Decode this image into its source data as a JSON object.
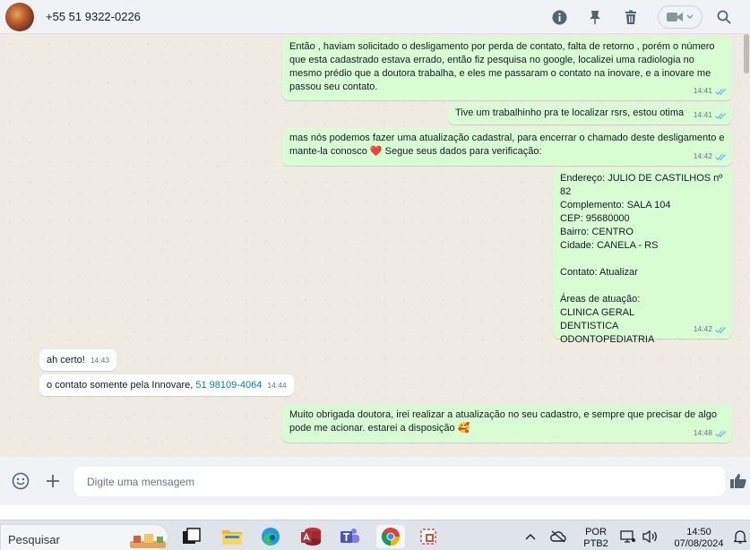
{
  "header": {
    "contact_name": "+55 51 9322-0226"
  },
  "messages": [
    {
      "direction": "out",
      "text": "Então , haviam solicitado o desligamento por perda de contato, falta de retorno , porém o número que esta cadastrado estava errado, então fiz pesquisa no google, localizei uma radiologia no mesmo prédio que a doutora trabalha, e eles me passaram o contato na inovare, e a inovare me passou seu contato.",
      "time": "14:41"
    },
    {
      "direction": "out",
      "text": "Tive um trabalhinho pra te localizar rsrs, estou otima",
      "time": "14:41"
    },
    {
      "direction": "out",
      "text": "mas nós podemos fazer uma atualização cadastral, para encerrar o chamado deste desligamento e mante-la conosco",
      "emoji": "❤️",
      "text_after": " Segue seus dados para verificação:",
      "time": "14:42"
    },
    {
      "direction": "out",
      "text": "Endereço: JULIO DE CASTILHOS nº 82\nComplemento: SALA 104\nCEP: 95680000\nBairro: CENTRO\nCidade: CANELA - RS\n\nContato: Atualizar\n\nÁreas de atuação:\nCLINICA GERAL\nDENTISTICA\nODONTOPEDIATRIA",
      "time": "14:42"
    },
    {
      "direction": "in",
      "text": "ah certo!",
      "time": "14:43"
    },
    {
      "direction": "in",
      "text": "o contato somente pela Innovare, ",
      "link": "51 98109-4064",
      "time": "14:44"
    },
    {
      "direction": "out",
      "text": "Muito obrigada doutora, irei realizar a atualização no seu cadastro, e sempre que precisar de algo pode me acionar. estarei a disposição",
      "emoji": "🥰",
      "time": "14:48"
    }
  ],
  "composer": {
    "placeholder": "Digite uma mensagem"
  },
  "taskbar": {
    "search_label": "Pesquisar",
    "lang_line1": "POR",
    "lang_line2": "PTB2",
    "time": "14:50",
    "date": "07/08/2024"
  },
  "colors": {
    "outgoing_bubble": "#d9fdd3",
    "incoming_bubble": "#ffffff",
    "read_ticks": "#53bdeb",
    "link": "#027eb5"
  }
}
